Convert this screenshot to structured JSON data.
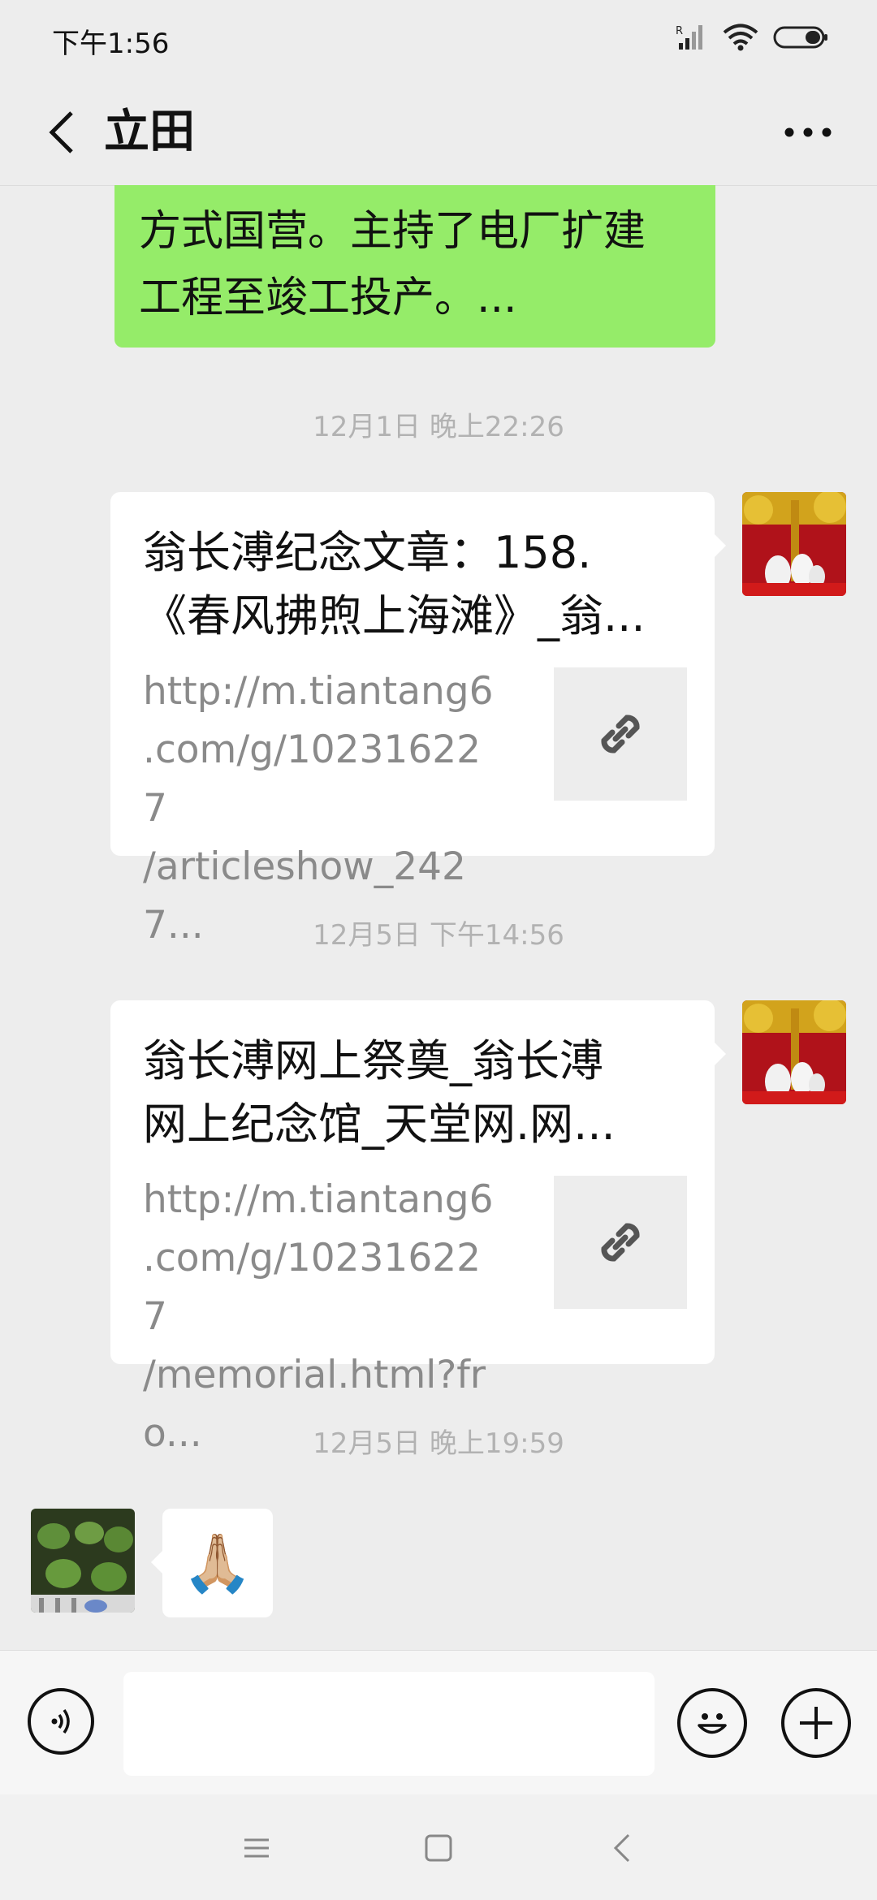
{
  "status_bar": {
    "time": "下午1:56"
  },
  "nav": {
    "title": "立田"
  },
  "messages": {
    "green_bubble": {
      "line1": "方式国营。主持了电厂扩建",
      "line2": "工程至竣工投产。..."
    },
    "timestamp1": "12月1日 晚上22:26",
    "card1": {
      "title_line1": "翁长溥纪念文章：158.",
      "title_line2": "《春风拂煦上海滩》_翁...",
      "url_line1": "http://m.tiantang6",
      "url_line2": ".com/g/102316227",
      "url_line3": "/articleshow_2427..."
    },
    "timestamp2": "12月5日 下午14:56",
    "card2": {
      "title_line1": "翁长溥网上祭奠_翁长溥",
      "title_line2": "网上纪念馆_天堂网.网...",
      "url_line1": "http://m.tiantang6",
      "url_line2": ".com/g/102316227",
      "url_line3": "/memorial.html?fro..."
    },
    "timestamp3": "12月5日 晚上19:59",
    "emoji_message": "🙏🏼"
  },
  "input": {
    "placeholder": ""
  },
  "colors": {
    "background": "#ededed",
    "self_bubble": "#95ec69",
    "other_bubble": "#ffffff",
    "timestamp": "#b2b2b2"
  },
  "icons": {
    "back": "chevron-left-icon",
    "more": "more-dots-icon",
    "link": "link-icon",
    "voice": "voice-icon",
    "emoji": "smiley-icon",
    "plus": "plus-icon"
  }
}
